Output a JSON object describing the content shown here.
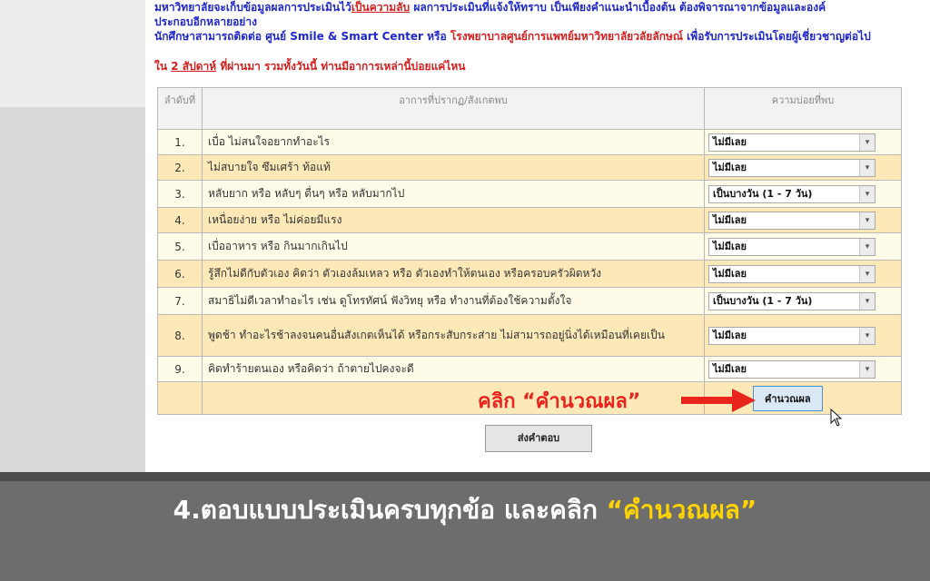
{
  "intro": {
    "line1_a": "มหาวิทยาลัยจะเก็บข้อมูลผลการประเมินไว้",
    "line1_secret": "เป็นความลับ",
    "line1_b": " ผลการประเมินที่แจ้งให้ทราบ เป็นเพียงคำแนะนำเบื้องต้น ต้องพิจารณาจากข้อมูลและองค์",
    "line2": "ประกอบอีกหลายอย่าง",
    "line3_a": "นักศึกษาสามารถติดต่อ ",
    "line3_center": "ศูนย์ Smile & Smart Center",
    "line3_or": " หรือ ",
    "line3_hospital": "โรงพยาบาลศูนย์การแพทย์มหาวิทยาลัยวลัยลักษณ์",
    "line3_b": " เพื่อรับการประเมินโดยผู้เชี่ยวชาญต่อไป"
  },
  "question": {
    "prefix": "ใน ",
    "period": "2 สัปดาห์",
    "suffix": " ที่ผ่านมา รวมทั้งวันนี้ ท่านมีอาการเหล่านี้บ่อยแค่ไหน"
  },
  "table": {
    "headers": [
      "ลำดับที่",
      "อาการที่ปรากฏ/สังเกตพบ",
      "ความบ่อยที่พบ"
    ],
    "rows": [
      {
        "num": "1.",
        "symptom": "เบื่อ ไม่สนใจอยากทำอะไร",
        "answer": "ไม่มีเลย"
      },
      {
        "num": "2.",
        "symptom": "ไม่สบายใจ ซึมเศร้า ท้อแท้",
        "answer": "ไม่มีเลย"
      },
      {
        "num": "3.",
        "symptom": "หลับยาก หรือ หลับๆ ตื่นๆ หรือ หลับมากไป",
        "answer": "เป็นบางวัน (1 - 7 วัน)"
      },
      {
        "num": "4.",
        "symptom": "เหนื่อยง่าย หรือ ไม่ค่อยมีแรง",
        "answer": "ไม่มีเลย"
      },
      {
        "num": "5.",
        "symptom": "เบื่ออาหาร หรือ กินมากเกินไป",
        "answer": "ไม่มีเลย"
      },
      {
        "num": "6.",
        "symptom": "รู้สึกไม่ดีกับตัวเอง คิดว่า ตัวเองล้มเหลว หรือ ตัวเองทำให้ตนเอง หรือครอบครัวผิดหวัง",
        "answer": "ไม่มีเลย"
      },
      {
        "num": "7.",
        "symptom": "สมาธิไม่ดีเวลาทำอะไร เช่น ดูโทรทัศน์ ฟังวิทยุ หรือ ทำงานที่ต้องใช้ความตั้งใจ",
        "answer": "เป็นบางวัน (1 - 7 วัน)"
      },
      {
        "num": "8.",
        "symptom": "พูดช้า ทำอะไรช้าลงจนคนอื่นสังเกตเห็นได้ หรือกระสับกระส่าย ไม่สามารถอยู่นิ่งได้เหมือนที่เคยเป็น",
        "answer": "ไม่มีเลย"
      },
      {
        "num": "9.",
        "symptom": "คิดทำร้ายตนเอง หรือคิดว่า ถ้าตายไปคงจะดี",
        "answer": "ไม่มีเลย"
      }
    ],
    "calc_button": "คำนวณผล"
  },
  "annotation": "คลิก “คำนวณผล”",
  "send_button": "ส่งคำตอบ",
  "banner": {
    "text": "4.ตอบแบบประเมินครบทุกข้อ และคลิก ",
    "highlight": "“คำนวณผล”"
  },
  "colors": {
    "accent_red": "#e8241c",
    "link_blue": "#1f27c8",
    "row_odd": "#fffbe9",
    "row_even": "#fde9b8",
    "banner_bg": "#6d6d6d",
    "banner_highlight": "#ffd400"
  },
  "icons": {
    "arrow": "arrow-right-icon",
    "cursor": "mouse-pointer-icon",
    "dropdown": "chevron-down-icon"
  }
}
